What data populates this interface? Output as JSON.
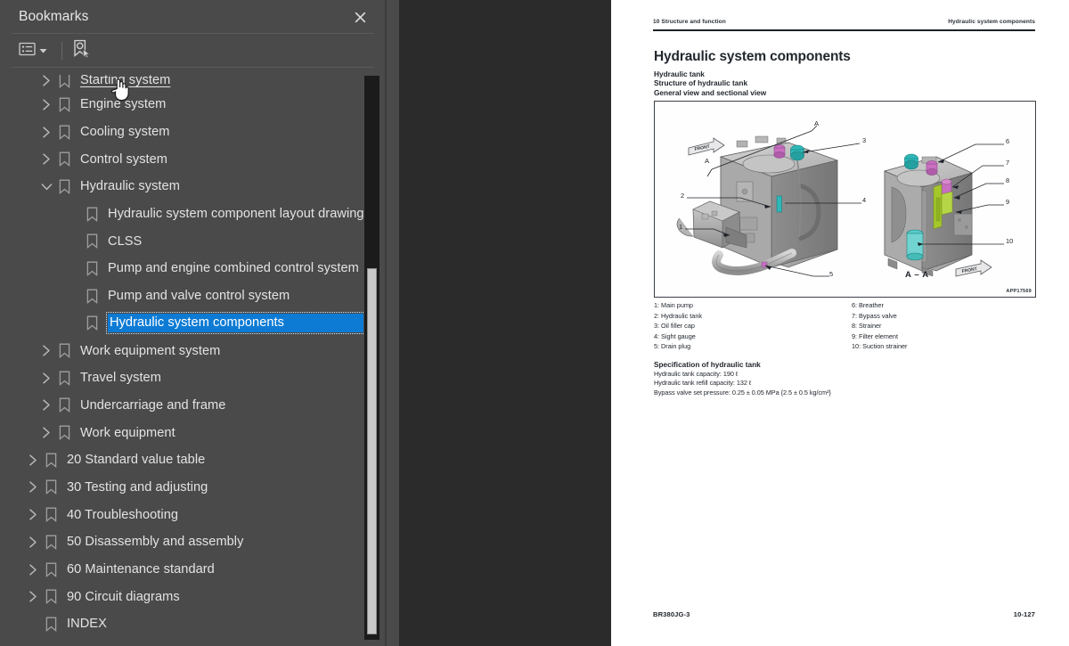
{
  "panel": {
    "title": "Bookmarks",
    "close_label": "✕",
    "toolbar": {
      "list_options_name": "list-options",
      "expand_caret": "▾",
      "new_bookmark_name": "new-bookmark"
    },
    "selection_color": "#0d7bd4",
    "background_color": "#4a4a4a"
  },
  "tree": [
    {
      "label": "Starting system",
      "level": 1,
      "state": "collapsed",
      "hovered": true,
      "selected": false,
      "clipped": true
    },
    {
      "label": "Engine system",
      "level": 1,
      "state": "collapsed",
      "hovered": false,
      "selected": false
    },
    {
      "label": "Cooling system",
      "level": 1,
      "state": "collapsed",
      "hovered": false,
      "selected": false
    },
    {
      "label": "Control system",
      "level": 1,
      "state": "collapsed",
      "hovered": false,
      "selected": false
    },
    {
      "label": "Hydraulic system",
      "level": 1,
      "state": "expanded",
      "hovered": false,
      "selected": false
    },
    {
      "label": "Hydraulic system component layout drawing",
      "level": 2,
      "state": "leaf",
      "hovered": false,
      "selected": false
    },
    {
      "label": "CLSS",
      "level": 2,
      "state": "leaf",
      "hovered": false,
      "selected": false
    },
    {
      "label": "Pump and engine combined control system",
      "level": 2,
      "state": "leaf",
      "hovered": false,
      "selected": false
    },
    {
      "label": "Pump and valve control system",
      "level": 2,
      "state": "leaf",
      "hovered": false,
      "selected": false
    },
    {
      "label": "Hydraulic system components",
      "level": 2,
      "state": "leaf",
      "hovered": false,
      "selected": true
    },
    {
      "label": "Work equipment system",
      "level": 1,
      "state": "collapsed",
      "hovered": false,
      "selected": false
    },
    {
      "label": "Travel system",
      "level": 1,
      "state": "collapsed",
      "hovered": false,
      "selected": false
    },
    {
      "label": "Undercarriage and frame",
      "level": 1,
      "state": "collapsed",
      "hovered": false,
      "selected": false
    },
    {
      "label": "Work equipment",
      "level": 1,
      "state": "collapsed",
      "hovered": false,
      "selected": false
    },
    {
      "label": "20 Standard value table",
      "level": 0,
      "state": "collapsed",
      "hovered": false,
      "selected": false
    },
    {
      "label": "30 Testing and adjusting",
      "level": 0,
      "state": "collapsed",
      "hovered": false,
      "selected": false
    },
    {
      "label": "40 Troubleshooting",
      "level": 0,
      "state": "collapsed",
      "hovered": false,
      "selected": false
    },
    {
      "label": "50 Disassembly and assembly",
      "level": 0,
      "state": "collapsed",
      "hovered": false,
      "selected": false
    },
    {
      "label": "60 Maintenance standard",
      "level": 0,
      "state": "collapsed",
      "hovered": false,
      "selected": false
    },
    {
      "label": "90 Circuit diagrams",
      "level": 0,
      "state": "collapsed",
      "hovered": false,
      "selected": false
    },
    {
      "label": "INDEX",
      "level": 0,
      "state": "leaf",
      "hovered": false,
      "selected": false
    }
  ],
  "document": {
    "running_head_left": "10 Structure and function",
    "running_head_right": "Hydraulic system components",
    "title": "Hydraulic system components",
    "subheads": [
      "Hydraulic tank",
      "Structure of hydraulic tank",
      "General view and sectional view"
    ],
    "figure": {
      "code": "APP17569",
      "section_label": "A – A",
      "front_arrow_label": "FRONT",
      "section_letters": [
        "A",
        "A"
      ],
      "callouts_left": [
        "1",
        "2",
        "3",
        "4",
        "5"
      ],
      "callouts_right": [
        "6",
        "7",
        "8",
        "9",
        "10"
      ]
    },
    "legend_col_1": [
      "1: Main pump",
      "2: Hydraulic tank",
      "3: Oil filler cap",
      "4: Sight gauge",
      "5: Drain plug"
    ],
    "legend_col_2": [
      "6: Breather",
      "7: Bypass valve",
      "8: Strainer",
      "9: Filter element",
      "10: Suction strainer"
    ],
    "spec_heading": "Specification of hydraulic tank",
    "spec_lines": [
      "Hydraulic tank capacity: 190 ℓ",
      "Hydraulic tank refill capacity: 132 ℓ",
      "Bypass valve set pressure: 0.25 ± 0.05 MPa {2.5 ± 0.5 kg/cm²}"
    ],
    "footer_left": "BR380JG-3",
    "footer_right": "10-127"
  }
}
